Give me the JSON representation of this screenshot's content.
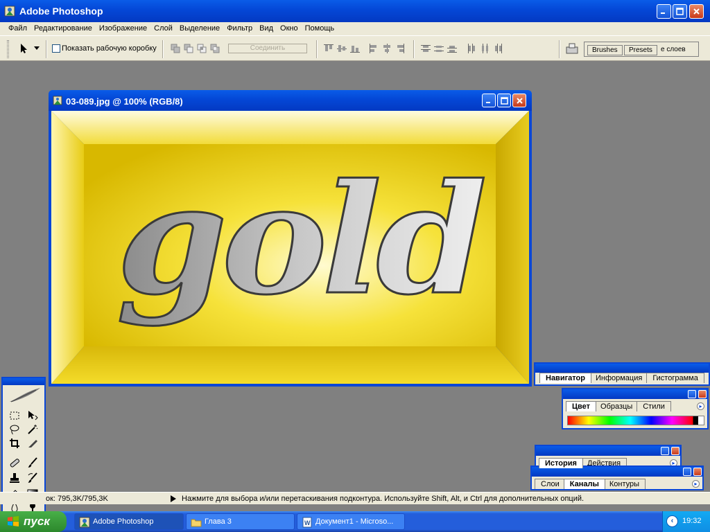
{
  "app": {
    "title": "Adobe Photoshop"
  },
  "menu": [
    "Файл",
    "Редактирование",
    "Изображение",
    "Слой",
    "Выделение",
    "Фильтр",
    "Вид",
    "Окно",
    "Помощь"
  ],
  "options": {
    "show_box_label": "Показать рабочую коробку",
    "combine_label": "Соединить",
    "well_tabs": [
      "Brushes",
      "Presets",
      "е слоев"
    ]
  },
  "document": {
    "title": "03-089.jpg @ 100% (RGB/8)",
    "image_text": "gold"
  },
  "palettes": {
    "navigator": [
      "Навигатор",
      "Информация",
      "Гистограмма"
    ],
    "color": [
      "Цвет",
      "Образцы",
      "Стили"
    ],
    "history": [
      "История",
      "Действия"
    ],
    "layers": [
      "Слои",
      "Каналы",
      "Контуры"
    ]
  },
  "status": {
    "doc_size": "ок: 795,3K/795,3K",
    "hint": "Нажмите для выбора и/или перетаскивания подконтура.  Используйте Shift, Alt, и Ctrl для дополнительных опций."
  },
  "taskbar": {
    "start_label": "пуск",
    "tasks": [
      "Adobe Photoshop",
      "Глава 3",
      "Документ1 - Microso..."
    ],
    "time": "19:32"
  },
  "colors": {
    "xp_blue": "#0a47d6",
    "gold": "#f0d81a",
    "workspace": "#808080"
  }
}
